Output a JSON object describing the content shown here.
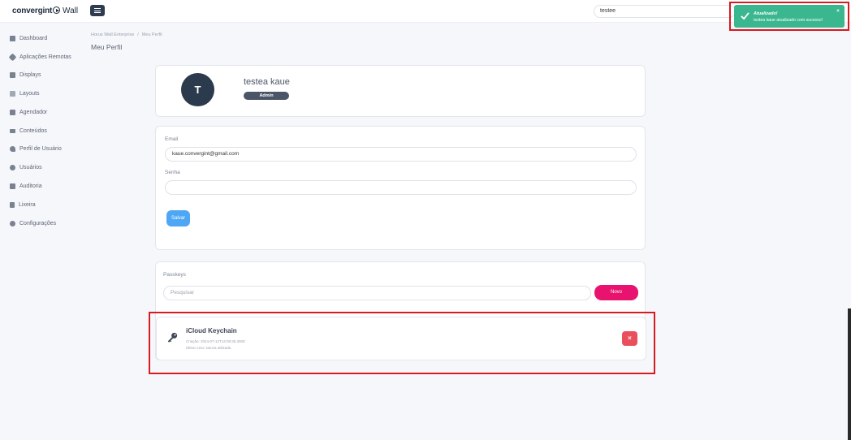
{
  "topbar": {
    "brand": "convergint",
    "product": "Wall",
    "search_value": "testee"
  },
  "sidebar": {
    "items": [
      {
        "label": "Dashboard",
        "icon": "dashboard-icon"
      },
      {
        "label": "Aplicações Remotas",
        "icon": "remote-apps-icon"
      },
      {
        "label": "Displays",
        "icon": "displays-icon"
      },
      {
        "label": "Layouts",
        "icon": "layouts-icon"
      },
      {
        "label": "Agendador",
        "icon": "calendar-icon"
      },
      {
        "label": "Conteúdos",
        "icon": "contents-icon"
      },
      {
        "label": "Perfil de Usuário",
        "icon": "key-icon"
      },
      {
        "label": "Usuários",
        "icon": "users-icon"
      },
      {
        "label": "Auditoria",
        "icon": "flag-icon"
      },
      {
        "label": "Lixeira",
        "icon": "trash-icon"
      },
      {
        "label": "Configurações",
        "icon": "gear-icon"
      }
    ]
  },
  "breadcrumb": {
    "root": "Horus Wall Enterprise",
    "separator": "/",
    "current": "Meu Perfil"
  },
  "page": {
    "title": "Meu Perfil"
  },
  "profile": {
    "avatar_initial": "T",
    "name": "testea kaue",
    "role": "Admin"
  },
  "form": {
    "email_label": "Email",
    "email_value": "kaue.convergint@gmail.com",
    "password_label": "Senha",
    "password_value": "",
    "save_label": "Salvar"
  },
  "passkeys": {
    "section_label": "Passkeys",
    "search_placeholder": "Pesquisar",
    "new_label": "Novo",
    "items": [
      {
        "name": "iCloud Keychain",
        "created": "Criação: 2024-07-12T14:08:36.300Z",
        "last_used": "Último Uso: Nunca utilizada",
        "delete_symbol": "×"
      }
    ]
  },
  "toast": {
    "title": "Atualizado!",
    "message": "testea kaue atualizado com sucesso!",
    "close_symbol": "×",
    "color": "#3bb78f"
  },
  "colors": {
    "accent_pink": "#e8136e",
    "save_blue": "#4ea7f5",
    "delete_red": "#ea4f5d",
    "highlight_red": "#d71920"
  }
}
